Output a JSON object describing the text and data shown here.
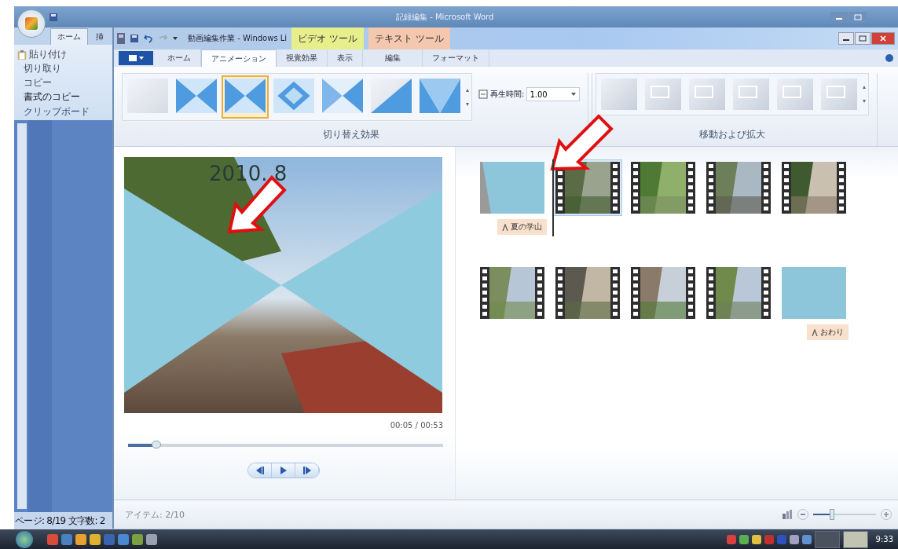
{
  "word_window": {
    "title": "記録編集 - Microsoft Word",
    "tabs": [
      {
        "label": "ホーム",
        "selected": true
      },
      {
        "label": "挿",
        "selected": false
      }
    ],
    "clipboard": {
      "paste": "貼り付け",
      "cut": "切り取り",
      "copy": "コピー",
      "format_painter": "書式のコピー",
      "group_label": "クリップボード"
    },
    "status_bar": [
      "ページ: 8/19",
      "文字数: 2"
    ]
  },
  "movie_maker": {
    "title": "動画編集作業 - Windows Li",
    "context_tabs": [
      {
        "label": "ビデオ ツール",
        "color": "#e6ef8c"
      },
      {
        "label": "テキスト ツール",
        "color": "#f4c8ae"
      }
    ],
    "tabs": [
      {
        "label": "ホーム",
        "selected": false
      },
      {
        "label": "アニメーション",
        "selected": true
      },
      {
        "label": "視覚効果",
        "selected": false
      },
      {
        "label": "表示",
        "selected": false
      },
      {
        "label": "編集",
        "selected": false
      },
      {
        "label": "フォーマット",
        "selected": false
      }
    ],
    "transitions": [
      {
        "kind": "blank",
        "selected": false
      },
      {
        "kind": "bowtie",
        "selected": false
      },
      {
        "kind": "bowtie",
        "selected": true
      },
      {
        "kind": "diamond",
        "selected": false
      },
      {
        "kind": "cross",
        "selected": false
      },
      {
        "kind": "diagonal",
        "selected": false
      },
      {
        "kind": "vee",
        "selected": false
      }
    ],
    "duration": {
      "label": "再生時間:",
      "value": "1.00"
    },
    "transitions_label": "切り替え効果",
    "pan_zoom_count_items": [
      {
        "selected": false
      },
      {
        "selected": false
      },
      {
        "selected": false
      },
      {
        "selected": false
      },
      {
        "selected": false
      },
      {
        "selected": false
      }
    ],
    "pan_zoom_label": "移動および拡大",
    "preview": {
      "overlay_text": "2010. 8",
      "time": "00:05 / 00:53",
      "position": {
        "level": 0.09
      }
    },
    "storyboard": [
      {
        "kind": "title",
        "caption": "夏の学山",
        "selected": false,
        "playhead": false
      },
      {
        "kind": "video",
        "selected": true,
        "playhead": true
      },
      {
        "kind": "video",
        "selected": false,
        "playhead": false
      },
      {
        "kind": "video",
        "selected": false,
        "playhead": false
      },
      {
        "kind": "video",
        "selected": false,
        "playhead": false
      },
      {
        "kind": "video",
        "selected": false,
        "playhead": false
      },
      {
        "kind": "video",
        "selected": false,
        "playhead": false
      },
      {
        "kind": "video",
        "selected": false,
        "playhead": false
      },
      {
        "kind": "video",
        "selected": false,
        "playhead": false
      },
      {
        "kind": "title",
        "caption": "おわり",
        "selected": false,
        "playhead": false
      }
    ],
    "status": {
      "items": "アイテム: 2/10",
      "zoom": {
        "level": 0.3
      }
    }
  },
  "taskbar": {
    "clock": "9:33"
  }
}
